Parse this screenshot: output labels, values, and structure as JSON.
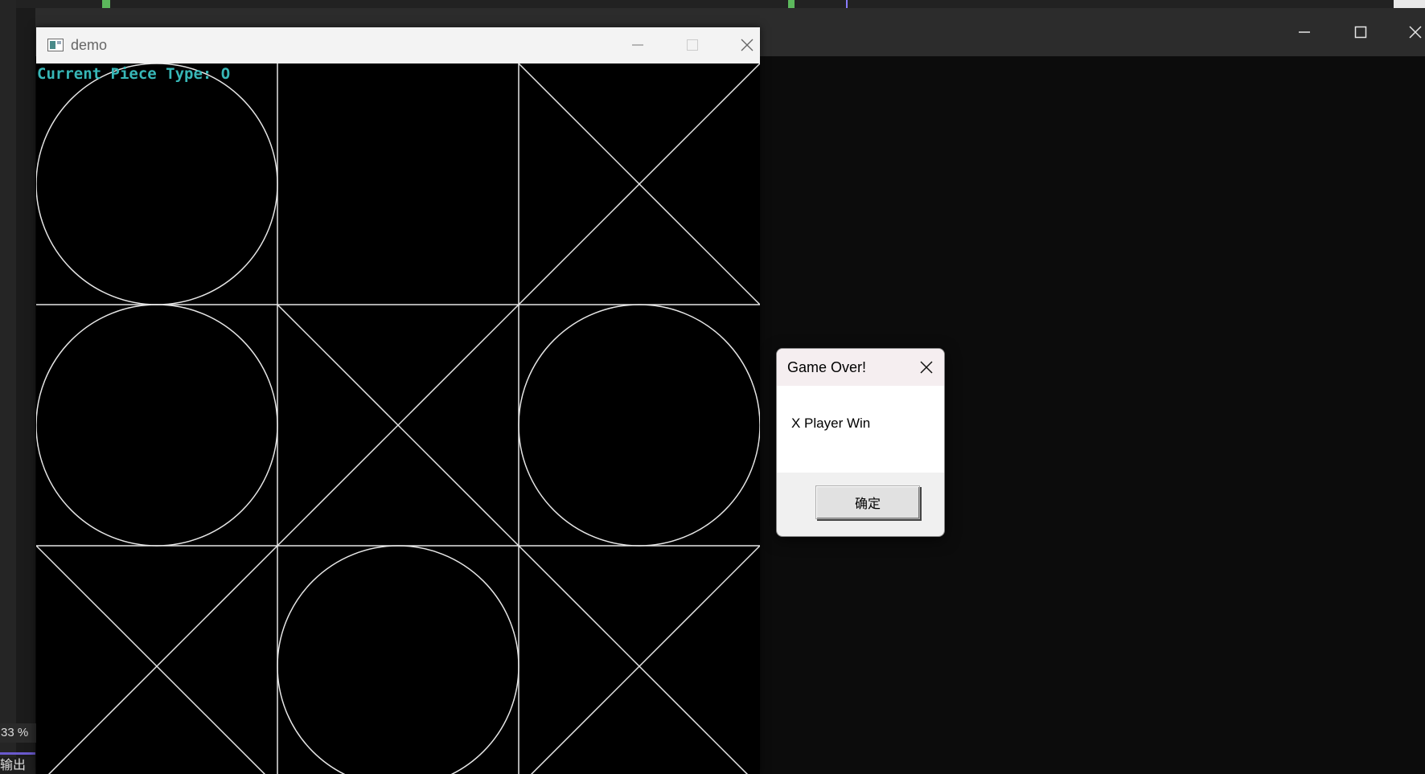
{
  "demo_window": {
    "title": "demo",
    "current_piece_label": "Current Piece Type: O",
    "board": [
      [
        "O",
        "",
        "X"
      ],
      [
        "O",
        "X",
        "O"
      ],
      [
        "X",
        "O",
        "X"
      ]
    ]
  },
  "dialog": {
    "title": "Game Over!",
    "message": "X Player Win",
    "ok_label": "确定"
  },
  "background": {
    "zoom": "33 %",
    "output_label": "输出"
  },
  "colors": {
    "label": "#37b7b7",
    "lines": "#e6e6e6",
    "canvas": "#000000"
  }
}
